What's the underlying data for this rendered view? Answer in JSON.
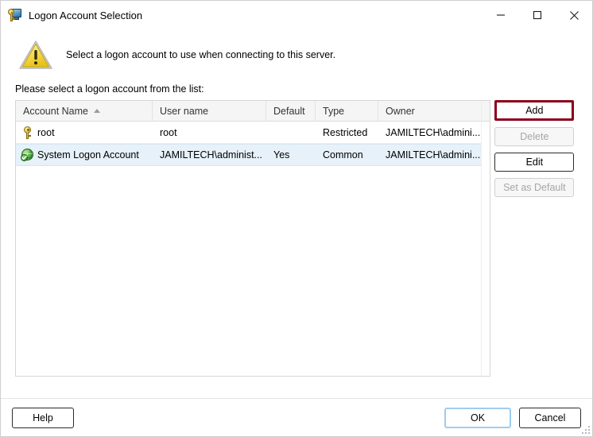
{
  "window": {
    "title": "Logon Account Selection",
    "icon": "key-monitor-icon",
    "controls": {
      "minimize": "minimize-icon",
      "maximize": "maximize-icon",
      "close": "close-icon"
    }
  },
  "banner": {
    "icon": "warning-triangle-icon",
    "text": "Select a logon account to use when connecting to this server."
  },
  "instruction": "Please select a logon account from the list:",
  "list": {
    "columns": [
      {
        "label": "Account Name",
        "sorted": "ascending",
        "width": 172
      },
      {
        "label": "User name",
        "width": 143
      },
      {
        "label": "Default",
        "width": 62
      },
      {
        "label": "Type",
        "width": 79
      },
      {
        "label": "Owner",
        "width": 132
      }
    ],
    "rows": [
      {
        "icon": "key-icon",
        "account_name": "root",
        "user_name": "root",
        "default": "",
        "type": "Restricted",
        "owner": "JAMILTECH\\admini...",
        "selected": false
      },
      {
        "icon": "globe-check-icon",
        "account_name": "System Logon Account",
        "user_name": "JAMILTECH\\administ...",
        "default": "Yes",
        "type": "Common",
        "owner": "JAMILTECH\\admini...",
        "selected": true
      }
    ]
  },
  "side_buttons": [
    {
      "label": "Add",
      "state": "highlighted"
    },
    {
      "label": "Delete",
      "state": "disabled"
    },
    {
      "label": "Edit",
      "state": "enabled"
    },
    {
      "label": "Set as Default",
      "state": "disabled"
    }
  ],
  "footer": {
    "help_label": "Help",
    "ok_label": "OK",
    "cancel_label": "Cancel"
  },
  "colors": {
    "highlight_border": "#8b0018",
    "focus_border": "#9ecdf0",
    "selected_row": "#e7f1fa",
    "header_bg": "#f5f5f5"
  }
}
